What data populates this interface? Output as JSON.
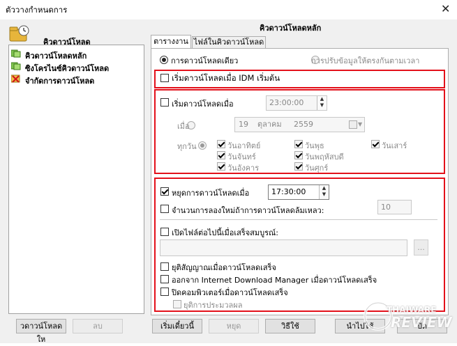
{
  "window": {
    "title": "ตัววางกำหนดการ"
  },
  "left": {
    "header": "คิวดาวน์โหลด",
    "items": [
      {
        "label": "คิวดาวน์โหลดหลัก",
        "icon": "queue-green-icon"
      },
      {
        "label": "ซิงโครไนซ์คิวดาวน์โหลด",
        "icon": "queue-green-icon"
      },
      {
        "label": "จำกัดการดาวน์โหลด",
        "icon": "red-x-icon"
      }
    ],
    "new_queue_label": "วดาวน์โหลดให",
    "delete_label": "ลบ"
  },
  "right": {
    "title": "คิวดาวน์โหลดหลัก",
    "tabs": [
      "ตารางงาน",
      "ไฟล์ในคิวดาวน์โหลด"
    ],
    "radio_once": "การดาวน์โหลดเดียว",
    "radio_sync": "การปรับข้อมูลให้ตรงกันตามเวลา",
    "start_on_idm": "เริ่มดาวน์โหลดเมื่อ IDM เริ่มต้น",
    "start_at": "เริ่มดาวน์โหลดเมื่อ",
    "start_time": "23:00:00",
    "on_label": "เมื่อ",
    "date_day": "19",
    "date_month": "ตุลาคม",
    "date_year": "2559",
    "every_label": "ทุกวัน",
    "days": [
      "วันอาทิตย์",
      "วันจันทร์",
      "วันอังคาร",
      "วันพุธ",
      "วันพฤหัสบดี",
      "วันศุกร์",
      "วันเสาร์"
    ],
    "stop_at": "หยุดการดาวน์โหลดเมื่อ",
    "stop_time": "17:30:00",
    "retry_label": "จำนวนการลองใหม่ถ้าการดาวน์โหลดล้มเหลว:",
    "retry_value": "10",
    "open_file_label": "เปิดไฟล์ต่อไปนี้เมื่อเสร็จสมบูรณ์:",
    "browse_label": "...",
    "hangup_label": "ยุติสัญญาณเมื่อดาวน์โหลดเสร็จ",
    "exit_idm_label": "ออกจาก Internet Download Manager เมื่อดาวน์โหลดเสร็จ",
    "shutdown_label": "ปิดคอมพิวเตอร์เมื่อดาวน์โหลดเสร็จ",
    "force_label": "ยุติการประมวลผล"
  },
  "buttons": {
    "start_now": "เริ่มเดี๋ยวนี้",
    "stop": "หยุด",
    "apply": "ใช้",
    "apply_prefix": "วิธี",
    "close": "ปิด",
    "help": "นำไปใช้"
  },
  "watermark": {
    "brand": "THAIWARE",
    "sub": "REVIEW"
  },
  "colors": {
    "highlight": "#e3101a"
  }
}
